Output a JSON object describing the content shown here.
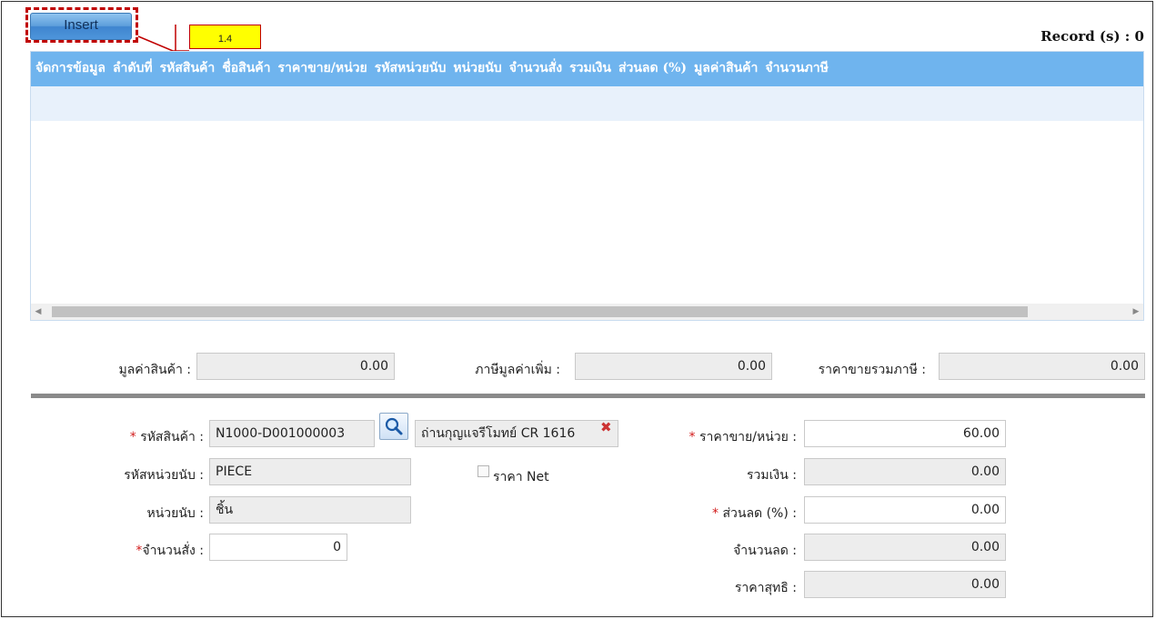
{
  "toolbar": {
    "insert_label": "Insert",
    "callout_label": "1.4"
  },
  "record": {
    "label": "Record (s) : 0"
  },
  "grid": {
    "columns": [
      "จัดการข้อมูล",
      "ลำดับที่",
      "รหัสสินค้า",
      "ชื่อสินค้า",
      "ราคาขาย/หน่วย",
      "รหัสหน่วยนับ",
      "หน่วยนับ",
      "จำนวนสั่ง",
      "รวมเงิน",
      "ส่วนลด (%)",
      "มูลค่าสินค้า",
      "จำนวนภาษี"
    ],
    "rows": []
  },
  "summary": {
    "product_value": {
      "label": "มูลค่าสินค้า :",
      "value": "0.00"
    },
    "vat": {
      "label": "ภาษีมูลค่าเพิ่ม :",
      "value": "0.00"
    },
    "total_with_vat": {
      "label": "ราคาขายรวมภาษี :",
      "value": "0.00"
    }
  },
  "form": {
    "product_code": {
      "label": "รหัสสินค้า :",
      "value": "N1000-D001000003",
      "name_value": "ถ่านกุญแจรีโมทย์ CR 1616"
    },
    "unit_code": {
      "label": "รหัสหน่วยนับ :",
      "value": "PIECE"
    },
    "unit": {
      "label": "หน่วยนับ :",
      "value": "ชิ้น"
    },
    "quantity": {
      "label": "จำนวนสั่ง :",
      "value": "0"
    },
    "net_price": {
      "label": "ราคา Net"
    },
    "unit_price": {
      "label": "ราคาขาย/หน่วย :",
      "value": "60.00"
    },
    "total": {
      "label": "รวมเงิน :",
      "value": "0.00"
    },
    "discount_pct": {
      "label": "ส่วนลด (%) :",
      "value": "0.00"
    },
    "discount_amount": {
      "label": "จำนวนลด :",
      "value": "0.00"
    },
    "net_total": {
      "label": "ราคาสุทธิ :",
      "value": "0.00"
    }
  },
  "icons": {
    "search": "magnifier-icon",
    "clear": "clear-x-icon",
    "scroll_left": "arrow-left-icon",
    "scroll_right": "arrow-right-icon"
  },
  "colors": {
    "header_bg": "#6fb4ee",
    "callout_bg": "#ffff00",
    "highlight": "#c00000",
    "required": "#d21b1b"
  }
}
